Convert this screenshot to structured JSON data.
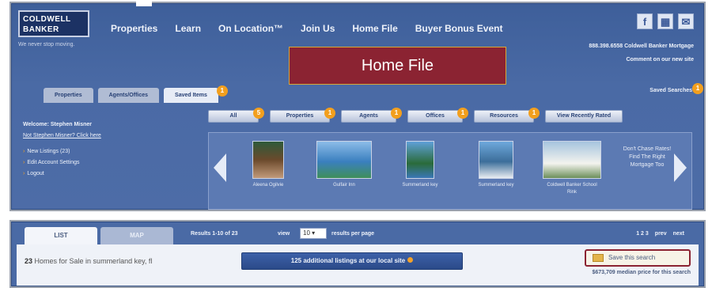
{
  "brand": {
    "logo_line1": "COLDWELL",
    "logo_line2": "BANKER",
    "tagline": "We never stop moving."
  },
  "nav": [
    "Properties",
    "Learn",
    "On Location™",
    "Join Us",
    "Home File",
    "Buyer Bonus Event"
  ],
  "social": {
    "facebook": "f",
    "tv": "▦",
    "mail": "✉"
  },
  "contact": {
    "phone_line": "888.398.6558 Coldwell Banker Mortgage",
    "comment_line": "Comment on our new site"
  },
  "banner": {
    "title": "Home File"
  },
  "subtabs": {
    "properties": "Properties",
    "agents": "Agents/Offices",
    "saved_items": "Saved Items",
    "saved_items_badge": "1",
    "saved_searches": "Saved Searches",
    "saved_searches_badge": "1"
  },
  "user": {
    "welcome": "Welcome: Stephen Misner",
    "not_me": "Not Stephen Misner? Click here",
    "links": [
      "New Listings (23)",
      "Edit Account Settings",
      "Logout"
    ]
  },
  "filters": [
    {
      "label": "All",
      "badge": "5"
    },
    {
      "label": "Properties",
      "badge": "1"
    },
    {
      "label": "Agents",
      "badge": "1"
    },
    {
      "label": "Offices",
      "badge": "1"
    },
    {
      "label": "Resources",
      "badge": "1"
    },
    {
      "label": "View Recently Rated",
      "badge": ""
    }
  ],
  "carousel": {
    "items": [
      "Aleena Ogilvie",
      "Gulfair Inn",
      "Summerland key",
      "Summerland key",
      "Coldwell Banker School Rink"
    ],
    "mortgage_text": "Don't Chase Rates! Find The Right Mortgage Too"
  },
  "results": {
    "tab_list": "LIST",
    "tab_map": "MAP",
    "range": "Results 1-10 of 23",
    "view_label": "view",
    "per_page_value": "10",
    "per_page_label": "results per page",
    "pager": [
      "1 2 3",
      "prev",
      "next"
    ],
    "homes_count": "23",
    "homes_text": "Homes for Sale in summerland key, fl",
    "extra_button": "125 additional listings at our local site",
    "save_search": "Save this search",
    "median": "$673,709 median price for this search"
  },
  "colors": {
    "header_blue": "#4a6aa5",
    "banner_red": "#8b2332",
    "banner_border": "#d4a83a",
    "badge_orange": "#f29f1e"
  }
}
